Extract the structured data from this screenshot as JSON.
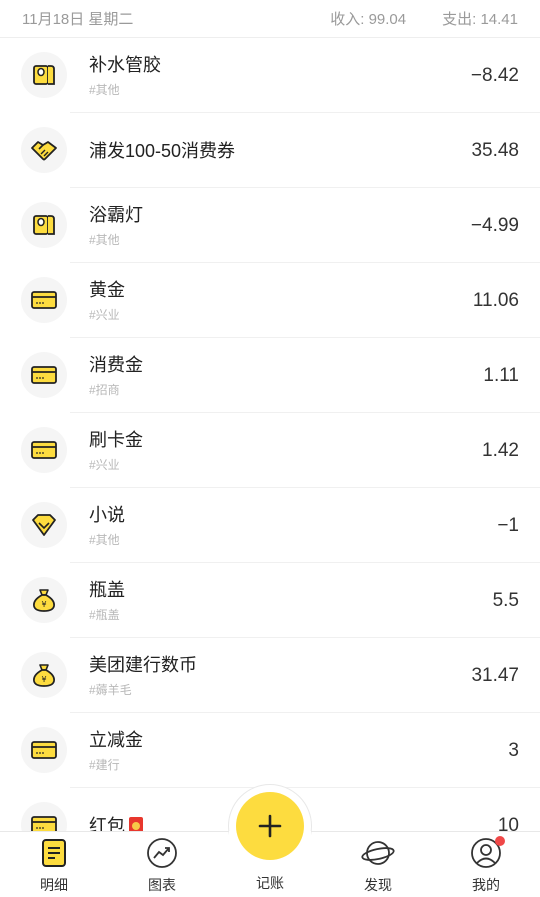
{
  "header": {
    "date": "11月18日 星期二",
    "income_label": "收入:",
    "income_value": "99.04",
    "expense_label": "支出:",
    "expense_value": "14.41"
  },
  "records": [
    {
      "name": "补水管胶",
      "tag": "#其他",
      "amount": "−8.42",
      "icon": "toilet-paper-icon"
    },
    {
      "name": "浦发100-50消费券",
      "tag": "",
      "amount": "35.48",
      "icon": "handshake-icon"
    },
    {
      "name": "浴霸灯",
      "tag": "#其他",
      "amount": "−4.99",
      "icon": "toilet-paper-icon"
    },
    {
      "name": "黄金",
      "tag": "#兴业",
      "amount": "11.06",
      "icon": "card-icon"
    },
    {
      "name": "消费金",
      "tag": "#招商",
      "amount": "1.11",
      "icon": "card-icon"
    },
    {
      "name": "刷卡金",
      "tag": "#兴业",
      "amount": "1.42",
      "icon": "card-icon"
    },
    {
      "name": "小说",
      "tag": "#其他",
      "amount": "−1",
      "icon": "diamond-icon"
    },
    {
      "name": "瓶盖",
      "tag": "#瓶盖",
      "amount": "5.5",
      "icon": "money-bag-icon"
    },
    {
      "name": "美团建行数币",
      "tag": "#薅羊毛",
      "amount": "31.47",
      "icon": "money-bag-icon"
    },
    {
      "name": "立减金",
      "tag": "#建行",
      "amount": "3",
      "icon": "card-icon"
    },
    {
      "name": "红包",
      "tag": "",
      "amount": "10",
      "icon": "card-icon",
      "badge_icon": "red-envelope-icon"
    }
  ],
  "tabbar": {
    "details": "明细",
    "charts": "图表",
    "add": "记账",
    "discover": "发现",
    "mine": "我的"
  },
  "colors": {
    "accent": "#fddc3f",
    "notification": "#f04848"
  }
}
